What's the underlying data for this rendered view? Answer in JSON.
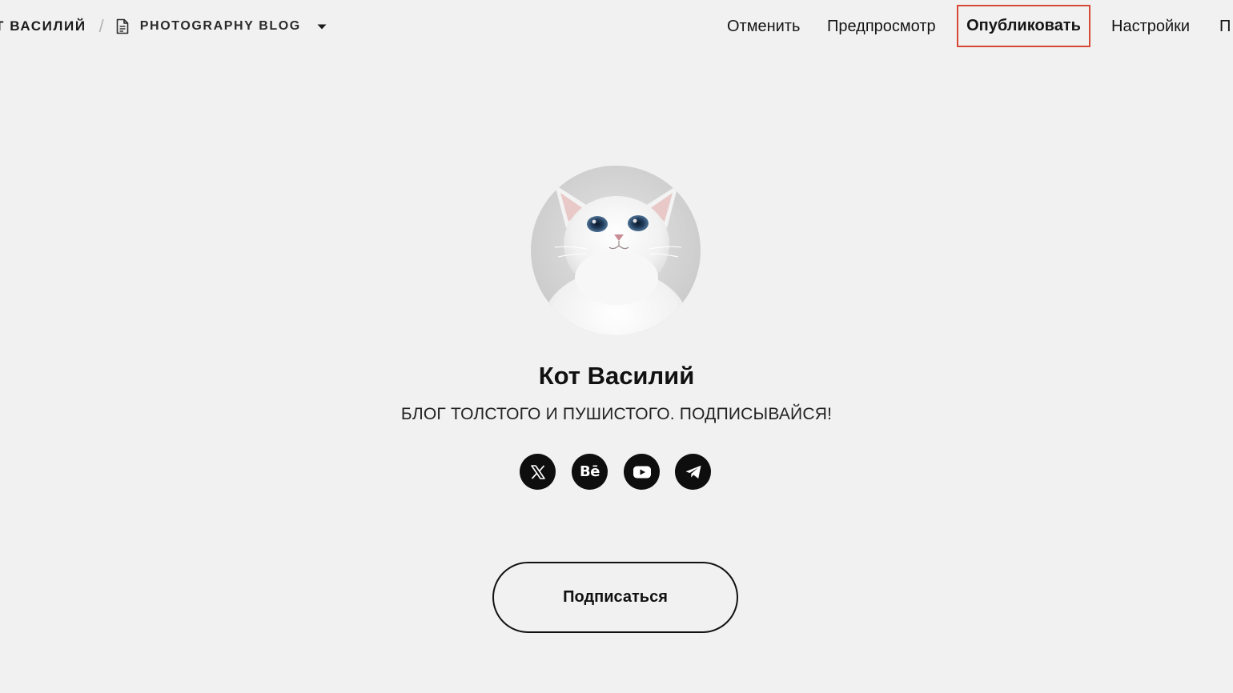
{
  "breadcrumb": {
    "site_name": "Т ВАСИЛИЙ",
    "separator": "/",
    "page_name": "PHOTOGRAPHY BLOG"
  },
  "toolbar": {
    "cancel_label": "Отменить",
    "preview_label": "Предпросмотр",
    "publish_label": "Опубликовать",
    "settings_label": "Настройки",
    "more_label": "П"
  },
  "profile": {
    "name": "Кот Василий",
    "description": "БЛОГ ТОЛСТОГО И ПУШИСТОГО. ПОДПИСЫВАЙСЯ!",
    "social": [
      {
        "icon": "x-icon",
        "label": "X"
      },
      {
        "icon": "behance-icon",
        "label": "Bē"
      },
      {
        "icon": "youtube-icon",
        "label": ""
      },
      {
        "icon": "telegram-icon",
        "label": ""
      }
    ],
    "subscribe_label": "Подписаться"
  },
  "colors": {
    "background": "#f1f1f1",
    "text": "#111111",
    "highlight_border": "#d64a35",
    "social_bg": "#0e0e0e"
  }
}
